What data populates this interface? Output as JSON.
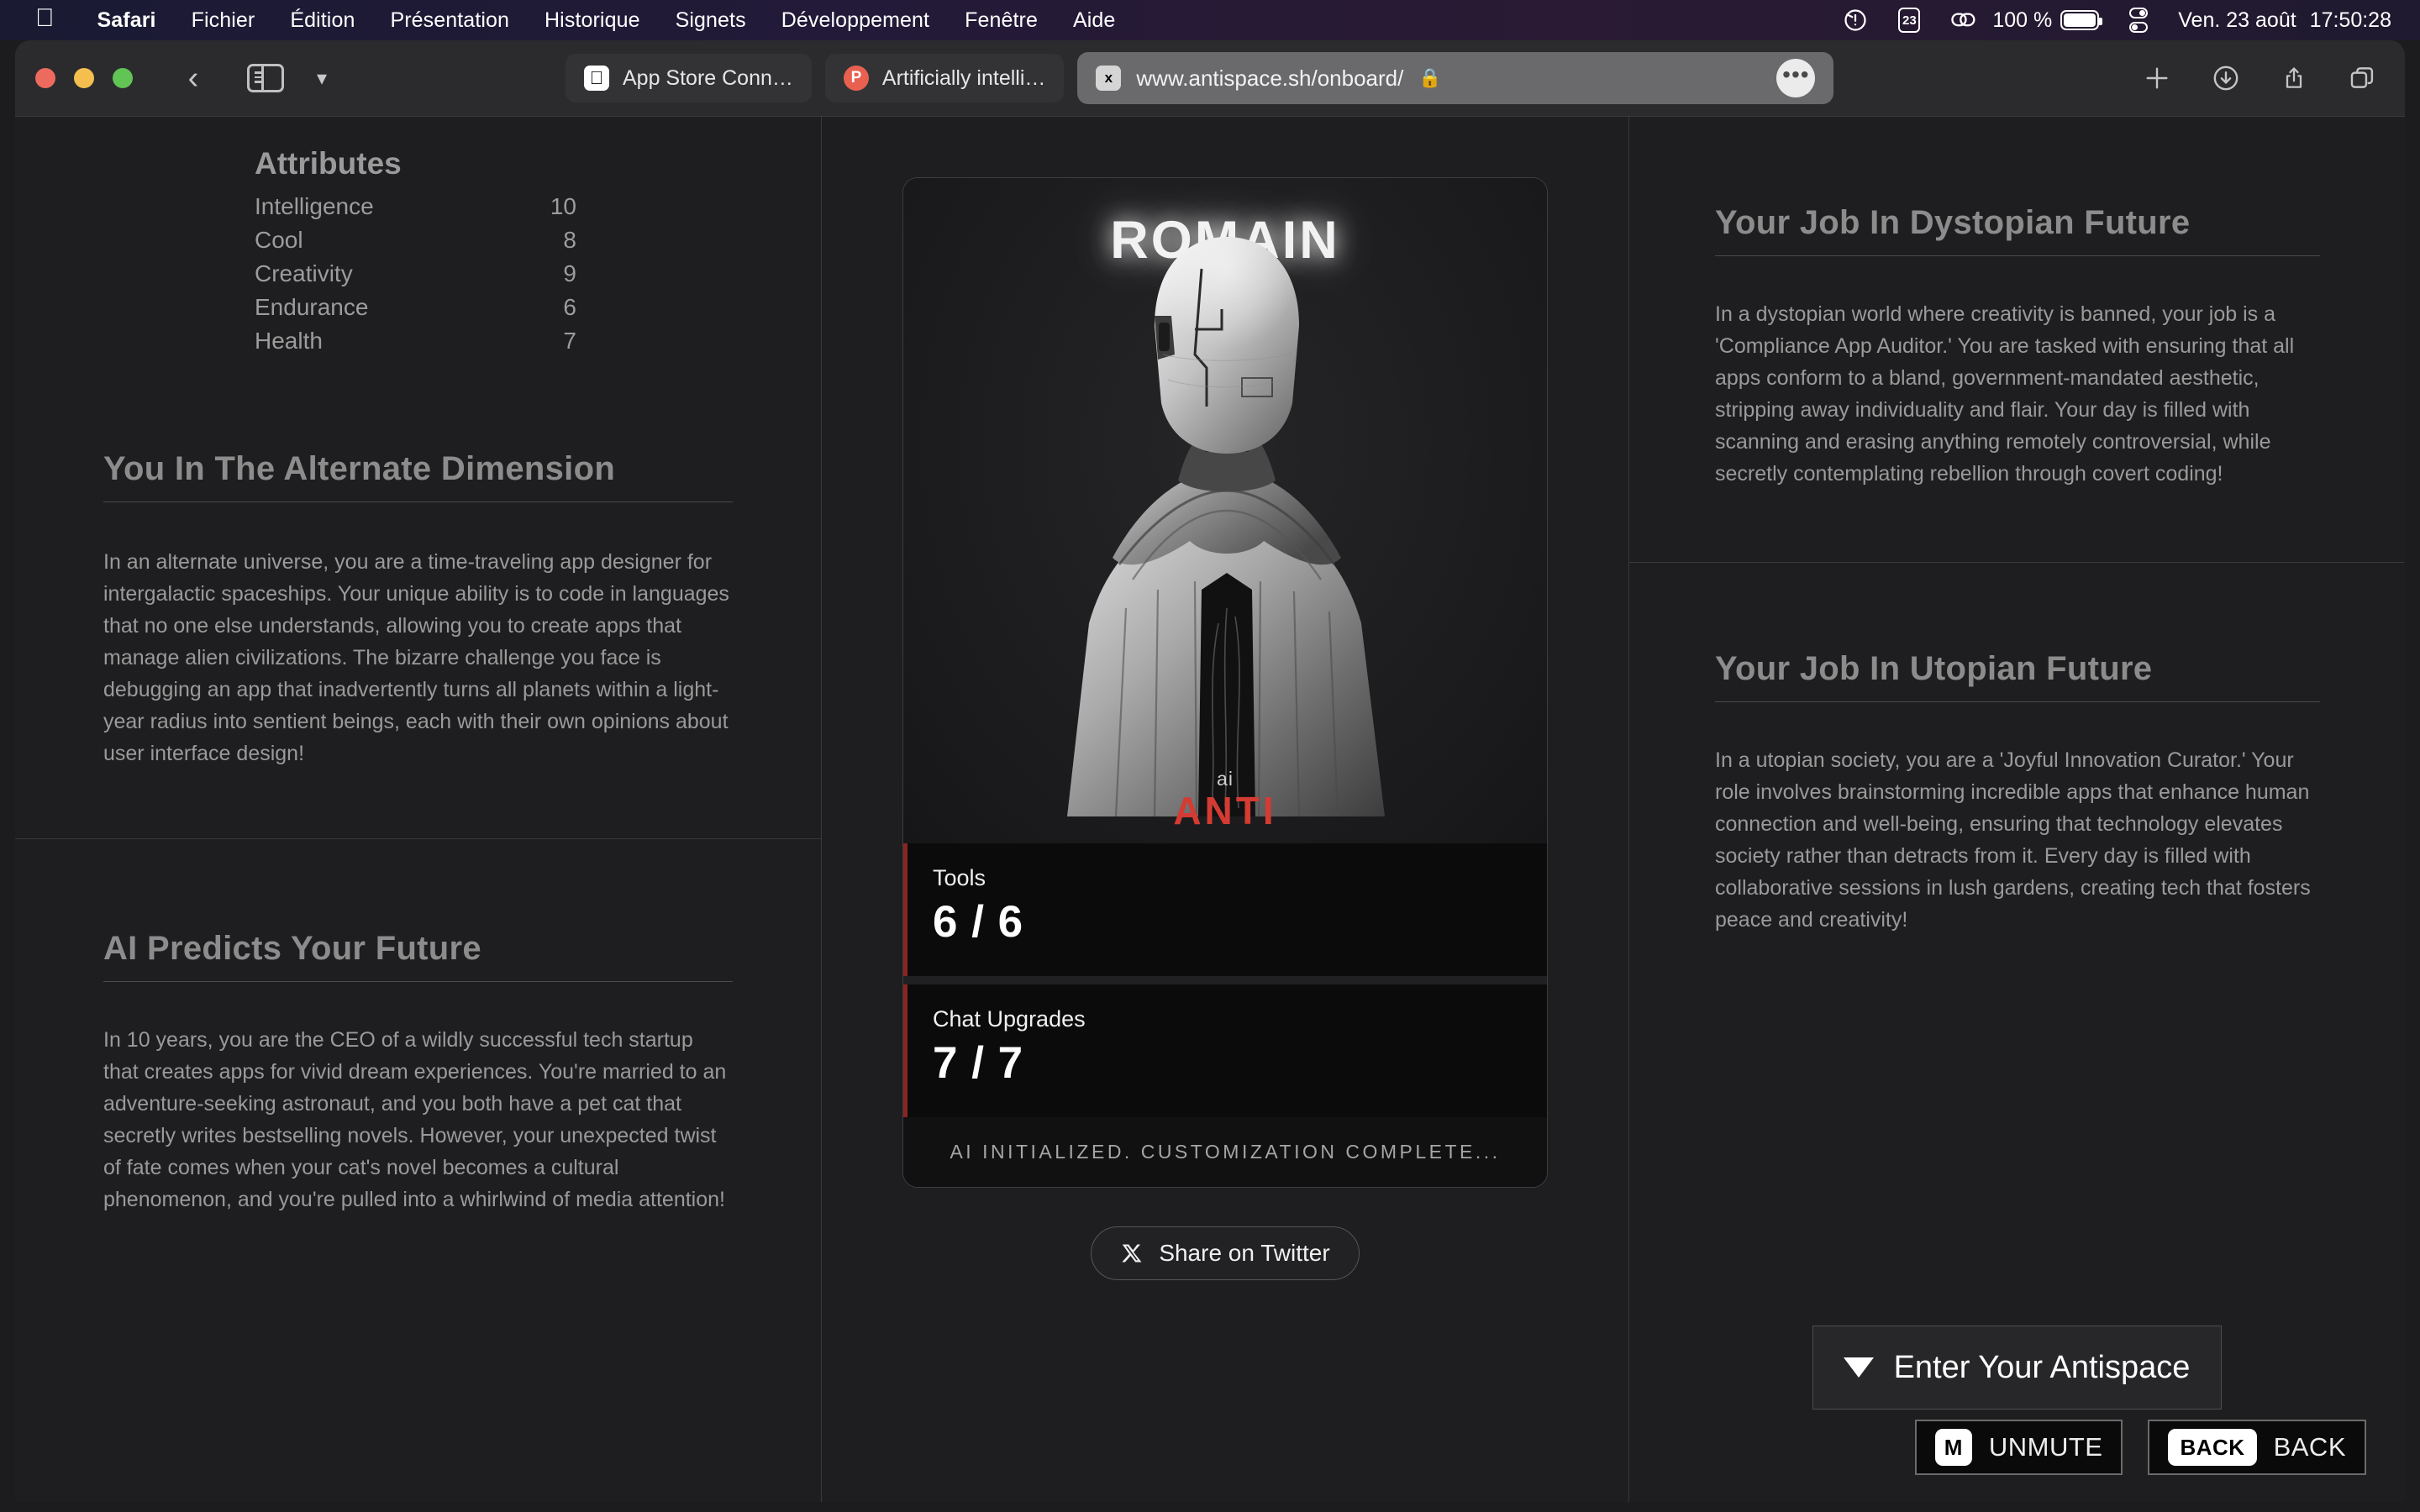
{
  "menubar": {
    "apple_glyph": "",
    "items": [
      {
        "label": "Safari",
        "bold": true
      },
      {
        "label": "Fichier",
        "bold": false
      },
      {
        "label": "Édition",
        "bold": false
      },
      {
        "label": "Présentation",
        "bold": false
      },
      {
        "label": "Historique",
        "bold": false
      },
      {
        "label": "Signets",
        "bold": false
      },
      {
        "label": "Développement",
        "bold": false
      },
      {
        "label": "Fenêtre",
        "bold": false
      },
      {
        "label": "Aide",
        "bold": false
      }
    ],
    "calendar_day": "23",
    "battery_percent": "100 %",
    "date": "Ven. 23 août",
    "time": "17:50:28"
  },
  "safari": {
    "tabs": [
      {
        "favicon": "apple-icon",
        "title": "App Store Conn…"
      },
      {
        "favicon": "p-icon",
        "title": "Artificially intelli…"
      }
    ],
    "address_bar": {
      "favicon": "x-icon",
      "url": "www.antispace.sh/onboard/",
      "lock": "🔒",
      "more": "•••"
    },
    "toolbar_right_icons": [
      "new-tab-icon",
      "downloads-icon",
      "share-icon",
      "tab-overview-icon"
    ]
  },
  "left": {
    "attributes": {
      "title": "Attributes",
      "rows": [
        {
          "name": "Intelligence",
          "value": "10"
        },
        {
          "name": "Cool",
          "value": "8"
        },
        {
          "name": "Creativity",
          "value": "9"
        },
        {
          "name": "Endurance",
          "value": "6"
        },
        {
          "name": "Health",
          "value": "7"
        }
      ]
    },
    "alternate": {
      "heading": "You In The Alternate Dimension",
      "body": "In an alternate universe, you are a time-traveling app designer for intergalactic spaceships. Your unique ability is to code in languages that no one else understands, allowing you to create apps that manage alien civilizations. The bizarre challenge you face is debugging an app that inadvertently turns all planets within a light-year radius into sentient beings, each with their own opinions about user interface design!"
    },
    "future": {
      "heading": "AI Predicts Your Future",
      "body": "In 10 years, you are the CEO of a wildly successful tech startup that creates apps for vivid dream experiences. You're married to an adventure-seeking astronaut, and you both have a pet cat that secretly writes bestselling novels. However, your unexpected twist of fate comes when your cat's novel becomes a cultural phenomenon, and you're pulled into a whirlwind of media attention!"
    }
  },
  "card": {
    "name": "ROMAIN",
    "brand_ai": "ai",
    "brand_anti": "ANTI",
    "stats": [
      {
        "label": "Tools",
        "value": "6 / 6"
      },
      {
        "label": "Chat Upgrades",
        "value": "7 / 7"
      }
    ],
    "console_text": "AI INITIALIZED. CUSTOMIZATION COMPLETE...",
    "share_button": "Share on Twitter",
    "share_icon": "x-twitter-icon"
  },
  "right": {
    "dystopian": {
      "heading": "Your Job In Dystopian Future",
      "body": "In a dystopian world where creativity is banned, your job is a 'Compliance App Auditor.' You are tasked with ensuring that all apps conform to a bland, government-mandated aesthetic, stripping away individuality and flair. Your day is filled with scanning and erasing anything remotely controversial, while secretly contemplating rebellion through covert coding!"
    },
    "utopian": {
      "heading": "Your Job In Utopian Future",
      "body": "In a utopian society, you are a 'Joyful Innovation Curator.' Your role involves brainstorming incredible apps that enhance human connection and well-being, ensuring that technology elevates society rather than detracts from it. Every day is filled with collaborative sessions in lush gardens, creating tech that fosters peace and creativity!"
    },
    "enter_button": "Enter Your Antispace"
  },
  "hud": {
    "unmute_key": "M",
    "unmute_label": "UNMUTE",
    "back_key": "BACK",
    "back_label": "BACK"
  },
  "colors": {
    "accent_red": "#d33b33",
    "stat_border": "#8a2420",
    "page_bg": "#1e1e20"
  }
}
